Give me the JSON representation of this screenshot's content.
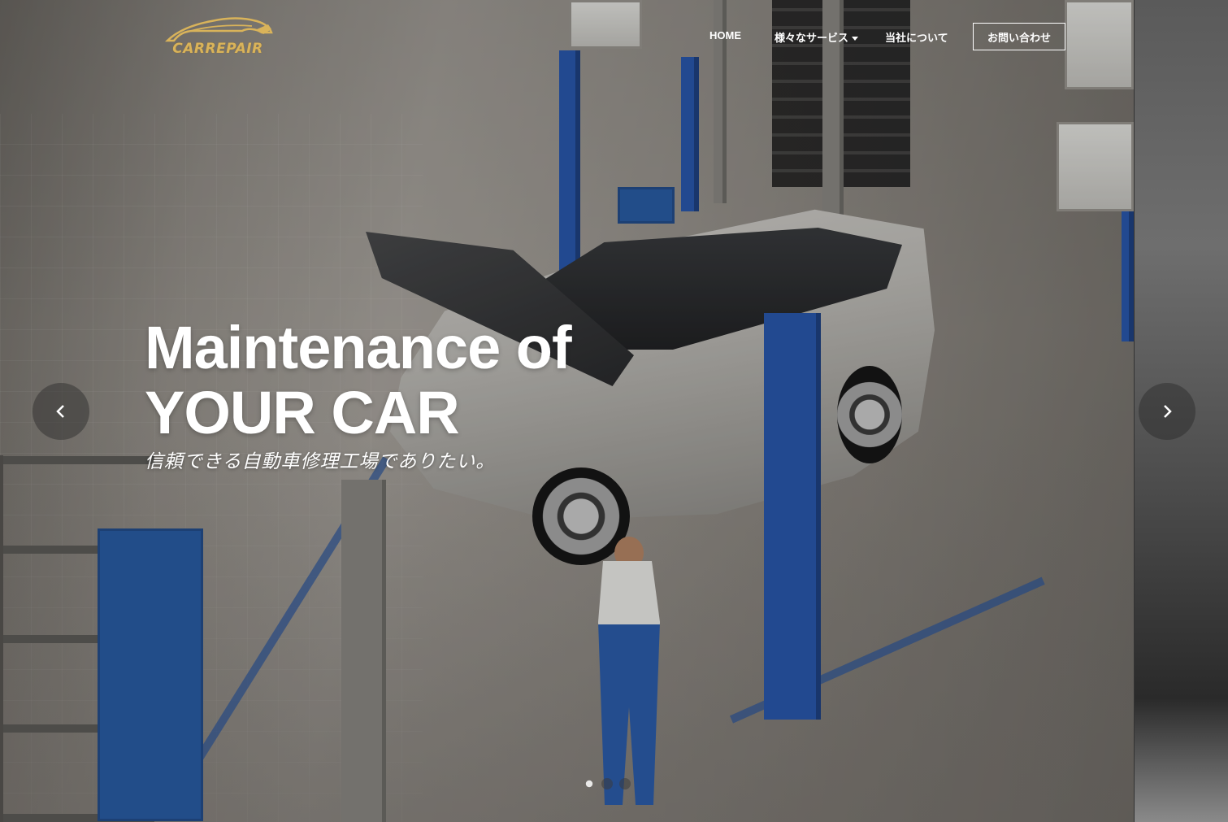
{
  "brand": {
    "logo_text": "CARREPAIR",
    "logo_color": "#d9b35a"
  },
  "nav": {
    "home": "HOME",
    "services": "様々なサービス",
    "about": "当社について",
    "contact": "お問い合わせ"
  },
  "hero": {
    "title_line1": "Maintenance of",
    "title_line2": "YOUR CAR",
    "subtitle": "信頼できる自動車修理工場でありたい。"
  },
  "carousel": {
    "prev_icon": "chevron-left-icon",
    "next_icon": "chevron-right-icon",
    "slide_count": 3,
    "active_slide": 1
  },
  "colors": {
    "accent_gold": "#d9b35a",
    "lift_blue": "#2a59b0",
    "text": "#ffffff"
  }
}
